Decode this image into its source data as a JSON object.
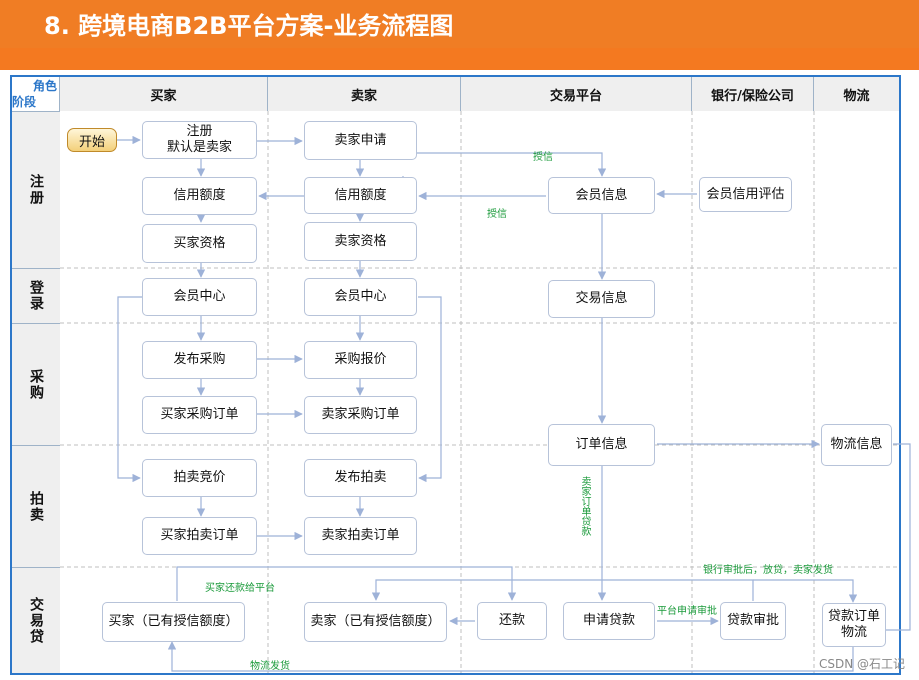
{
  "title": "8.  跨境电商B2B平台方案-业务流程图",
  "corner": {
    "role": "角色",
    "stage": "阶段"
  },
  "columns": [
    "买家",
    "卖家",
    "交易平台",
    "银行/保险公司",
    "物流"
  ],
  "stages": [
    "注册",
    "登录",
    "采购",
    "拍卖",
    "交易贷"
  ],
  "nodes": {
    "start": "开始",
    "reg": "注册\n默认是卖家",
    "buyer_credit": "信用额度",
    "buyer_qual": "买家资格",
    "buyer_center": "会员中心",
    "publish_purchase": "发布采购",
    "buyer_purchase_order": "买家采购订单",
    "auction_bid": "拍卖竞价",
    "buyer_auction_order": "买家拍卖订单",
    "buyer_credited": "买家（已有授信额度）",
    "seller_apply": "卖家申请",
    "seller_credit": "信用额度",
    "seller_qual": "卖家资格",
    "seller_center": "会员中心",
    "purchase_quote": "采购报价",
    "seller_purchase_order": "卖家采购订单",
    "publish_auction": "发布拍卖",
    "seller_auction_order": "卖家拍卖订单",
    "seller_credited": "卖家（已有授信额度）",
    "repay": "还款",
    "member_info": "会员信息",
    "trade_info": "交易信息",
    "order_info": "订单信息",
    "apply_loan": "申请贷款",
    "credit_eval": "会员信用评估",
    "loan_approval": "贷款审批",
    "logistics_info": "物流信息",
    "loan_order_logistics": "贷款订单\n物流"
  },
  "annotations": {
    "credit1": "授信",
    "credit2": "授信",
    "seller_order_loan": "卖家订单贷款",
    "buyer_repay": "买家还款给平台",
    "bank_approve": "银行审批后，放贷，卖家发货",
    "platform_apply": "平台申请审批",
    "logistics_ship": "物流发货"
  },
  "watermark": "CSDN @石工记"
}
